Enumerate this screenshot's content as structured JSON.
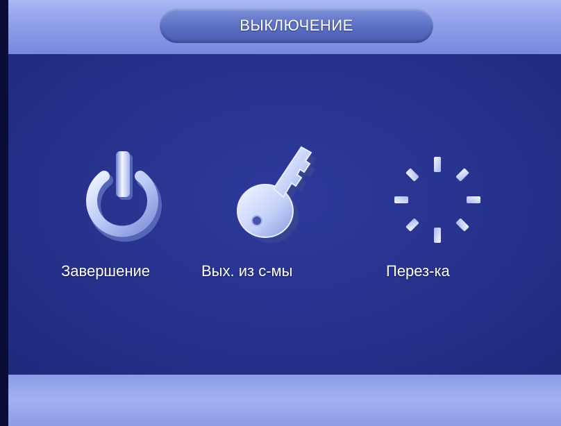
{
  "header": {
    "title": "ВЫКЛЮЧЕНИЕ"
  },
  "menu": {
    "items": [
      {
        "id": "shutdown",
        "label": "Завершение",
        "icon": "power-icon"
      },
      {
        "id": "logout",
        "label": "Вых. из с-мы",
        "icon": "key-icon"
      },
      {
        "id": "reboot",
        "label": "Перез-ка",
        "icon": "reboot-spinner-icon"
      }
    ]
  },
  "colors": {
    "panel": "#27328c",
    "header_bar": "#8f9fea",
    "title_pill": "#5b6fc2",
    "icon_light": "#d8e4ff",
    "icon_dark": "#6a7cc8"
  }
}
